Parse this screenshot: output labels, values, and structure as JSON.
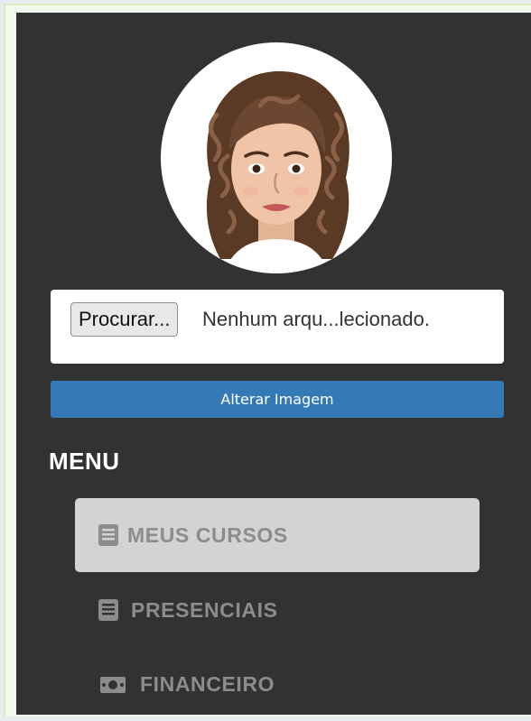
{
  "profile": {
    "avatar_icon": "female-avatar-curly-hair"
  },
  "upload": {
    "browse_label": "Procurar...",
    "status_text": "Nenhum arqu...lecionado.",
    "change_image_label": "Alterar Imagem"
  },
  "menu": {
    "heading": "MENU",
    "items": [
      {
        "label": "MEUS CURSOS",
        "icon": "book-icon",
        "active": true
      },
      {
        "label": "PRESENCIAIS",
        "icon": "book-icon",
        "active": false
      },
      {
        "label": "FINANCEIRO",
        "icon": "money-icon",
        "active": false
      }
    ]
  },
  "colors": {
    "panel_bg": "#323232",
    "primary_button": "#337ab7",
    "active_item_bg": "#d3d3d3",
    "menu_text": "#8c8c8c"
  }
}
